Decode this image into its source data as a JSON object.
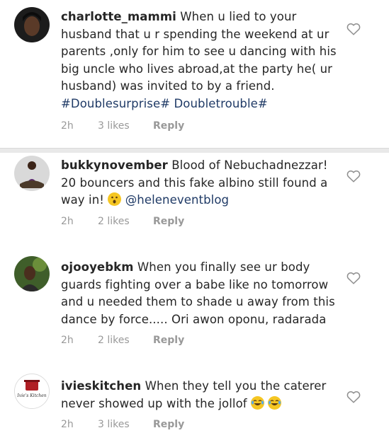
{
  "comments": [
    {
      "username": "charlotte_mammi",
      "text": " When u lied to your husband that u r spending the weekend at ur parents ,only for him to see  u dancing with his big uncle who lives abroad,at the party he( ur husband) was invited to by a friend.",
      "tags": "#Doublesurprise# Doubletrouble#",
      "time": "2h",
      "likes": "3 likes",
      "reply": "Reply"
    },
    {
      "username": "bukkynovember",
      "text": " Blood of Nebuchadnezzar! 20 bouncers and this fake albino still found a way in! ",
      "emoji": "astonished-face-emoji",
      "mention": "@heleneventblog",
      "time": "2h",
      "likes": "2 likes",
      "reply": "Reply"
    },
    {
      "username": "ojooyebkm",
      "text": " When you finally see ur body guards  fighting over a babe like no tomorrow and u needed them to shade u away from this dance by force..... Ori awon oponu, radarada",
      "time": "2h",
      "likes": "2 likes",
      "reply": "Reply"
    },
    {
      "username": "ivieskitchen",
      "text": " When they tell you the caterer never showed up with the jollof ",
      "emoji": "laughing-tears-emoji",
      "avatar_text": "Ivie's Kitchen",
      "time": "2h",
      "likes": "3 likes",
      "reply": "Reply"
    }
  ],
  "icons": {
    "like": "heart-outline-icon"
  },
  "colors": {
    "tag": "#1f3a66",
    "meta": "#999999",
    "divider": "#e9e9e9"
  }
}
